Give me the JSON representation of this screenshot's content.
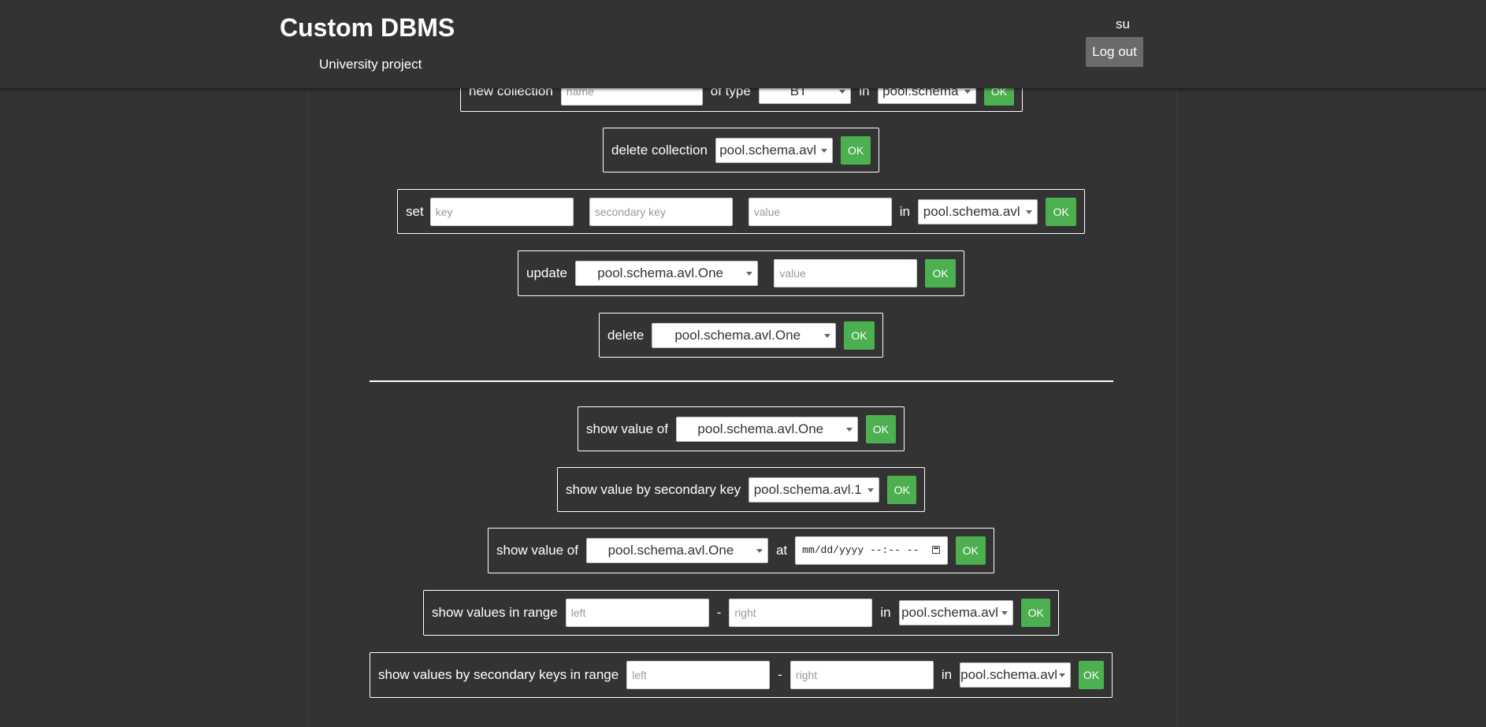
{
  "header": {
    "title": "Custom DBMS",
    "subtitle": "University project",
    "user": "su",
    "logout_label": "Log out"
  },
  "rows": {
    "new_collection": {
      "label": "new collection",
      "name_placeholder": "name",
      "of_type_label": "of type",
      "type_value": "BT",
      "in_label": "in",
      "schema_value": "pool.schema",
      "ok": "OK"
    },
    "delete_collection": {
      "label": "delete collection",
      "select_value": "pool.schema.avl",
      "ok": "OK"
    },
    "set": {
      "label": "set",
      "key_placeholder": "key",
      "secondary_key_placeholder": "secondary key",
      "value_placeholder": "value",
      "in_label": "in",
      "select_value": "pool.schema.avl",
      "ok": "OK"
    },
    "update": {
      "label": "update",
      "select_value": "pool.schema.avl.One",
      "value_placeholder": "value",
      "ok": "OK"
    },
    "delete": {
      "label": "delete",
      "select_value": "pool.schema.avl.One",
      "ok": "OK"
    },
    "show_value": {
      "label": "show value of",
      "select_value": "pool.schema.avl.One",
      "ok": "OK"
    },
    "show_value_secondary": {
      "label": "show value by secondary key",
      "select_value": "pool.schema.avl.1",
      "ok": "OK"
    },
    "show_value_at": {
      "label": "show value of",
      "select_value": "pool.schema.avl.One",
      "at_label": "at",
      "date_value": "mm/dd/yyyy --:-- --",
      "ok": "OK"
    },
    "show_range": {
      "label": "show values in range",
      "left_placeholder": "left",
      "dash": "-",
      "right_placeholder": "right",
      "in_label": "in",
      "select_value": "pool.schema.avl",
      "ok": "OK"
    },
    "show_range_secondary": {
      "label": "show values by secondary keys in range",
      "left_placeholder": "left",
      "dash": "-",
      "right_placeholder": "right",
      "in_label": "in",
      "select_value": "pool.schema.avl",
      "ok": "OK"
    }
  }
}
